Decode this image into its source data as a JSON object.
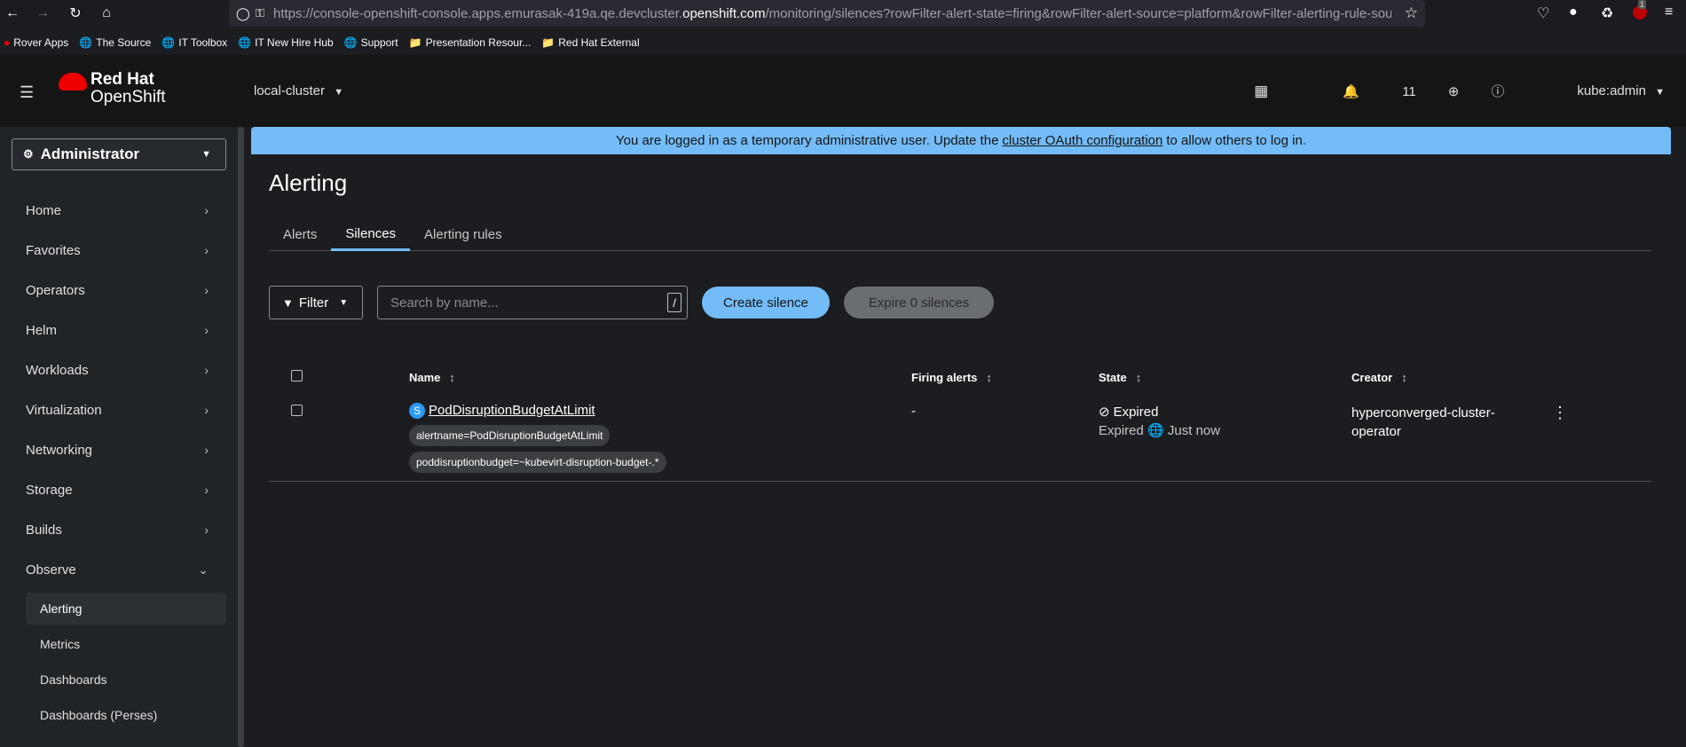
{
  "browser": {
    "url_prefix": "https://console-openshift-console.apps.emurasak-419a.qe.devcluster.",
    "url_domain": "openshift.com",
    "url_suffix": "/monitoring/silences?rowFilter-alert-state=firing&rowFilter-alert-source=platform&rowFilter-alerting-rule-source=",
    "ext_badge": "1"
  },
  "bookmarks": [
    "Rover Apps",
    "The Source",
    "IT Toolbox",
    "IT New Hire Hub",
    "Support",
    "Presentation Resour...",
    "Red Hat External"
  ],
  "masthead": {
    "logo_line1": "Red Hat",
    "logo_line2": "OpenShift",
    "cluster": "local-cluster",
    "notifications": "11",
    "user": "kube:admin"
  },
  "sidebar": {
    "perspective": "Administrator",
    "items": [
      "Home",
      "Favorites",
      "Operators",
      "Helm",
      "Workloads",
      "Virtualization",
      "Networking",
      "Storage",
      "Builds",
      "Observe"
    ],
    "observe_sub": [
      "Alerting",
      "Metrics",
      "Dashboards",
      "Dashboards (Perses)"
    ]
  },
  "banner": {
    "text_before": "You are logged in as a temporary administrative user. Update the",
    "link": "cluster OAuth configuration",
    "text_after": "to allow others to log in."
  },
  "page": {
    "title": "Alerting",
    "tabs": [
      "Alerts",
      "Silences",
      "Alerting rules"
    ],
    "active_tab": "Silences"
  },
  "toolbar": {
    "filter_label": "Filter",
    "search_placeholder": "Search by name...",
    "slash_hint": "/",
    "create_label": "Create silence",
    "expire_label": "Expire 0 silences"
  },
  "table": {
    "headers": {
      "name": "Name",
      "firing": "Firing alerts",
      "state": "State",
      "creator": "Creator"
    },
    "row": {
      "badge": "S",
      "name": "PodDisruptionBudgetAtLimit",
      "matcher1": "alertname=PodDisruptionBudgetAtLimit",
      "matcher2": "poddisruptionbudget=~kubevirt-disruption-budget-.*",
      "firing": "-",
      "state": "Expired",
      "state_sub": "Expired",
      "state_time": "Just now",
      "creator_line1": "hyperconverged-cluster-",
      "creator_line2": "operator"
    }
  }
}
